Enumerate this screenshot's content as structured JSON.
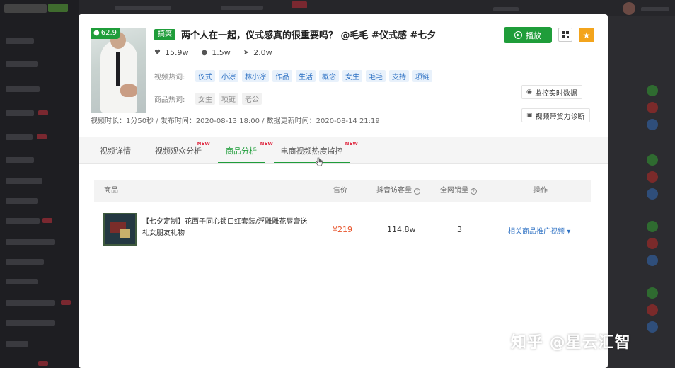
{
  "modal": {
    "score": "62.9",
    "tag": "搞笑",
    "title": "两个人在一起，仪式感真的很重要吗？ @毛毛 #仪式感 #七夕",
    "stats": {
      "likes": "15.9w",
      "comments": "1.5w",
      "shares": "2.0w"
    },
    "video_keywords_label": "视频热词:",
    "video_keywords": [
      "仪式",
      "小淙",
      "林小淙",
      "作品",
      "生活",
      "概念",
      "女生",
      "毛毛",
      "支持",
      "项链"
    ],
    "product_keywords_label": "商品热词:",
    "product_keywords": [
      "女生",
      "项链",
      "老公"
    ],
    "meta_line": "视频时长：1分50秒 / 发布时间：2020-08-13 18:00 / 数据更新时间：2020-08-14 21:19",
    "buttons": {
      "play": "播放",
      "monitor": "监控实时数据",
      "diagnose": "视频带货力诊断"
    },
    "tabs": [
      {
        "label": "视频详情",
        "new": ""
      },
      {
        "label": "视频观众分析",
        "new": "NEW"
      },
      {
        "label": "商品分析",
        "new": "NEW"
      },
      {
        "label": "电商视频热度监控",
        "new": "NEW"
      }
    ],
    "table": {
      "headers": {
        "product": "商品",
        "price": "售价",
        "visits": "抖音访客量",
        "sales": "全网销量",
        "actions": "操作"
      },
      "rows": [
        {
          "name": "【七夕定制】花西子同心锁口红套装/浮雕雕花唇膏送礼女朋友礼物",
          "price": "¥219",
          "visits": "114.8w",
          "sales": "3",
          "action": "相关商品推广视频"
        }
      ]
    }
  },
  "watermark": "知乎 @星云汇智",
  "colors": {
    "brand_green": "#1f9d3a",
    "star_orange": "#f3a41c",
    "price_red": "#e8542b",
    "link_blue": "#2f72c4",
    "new_red": "#e0344b"
  }
}
